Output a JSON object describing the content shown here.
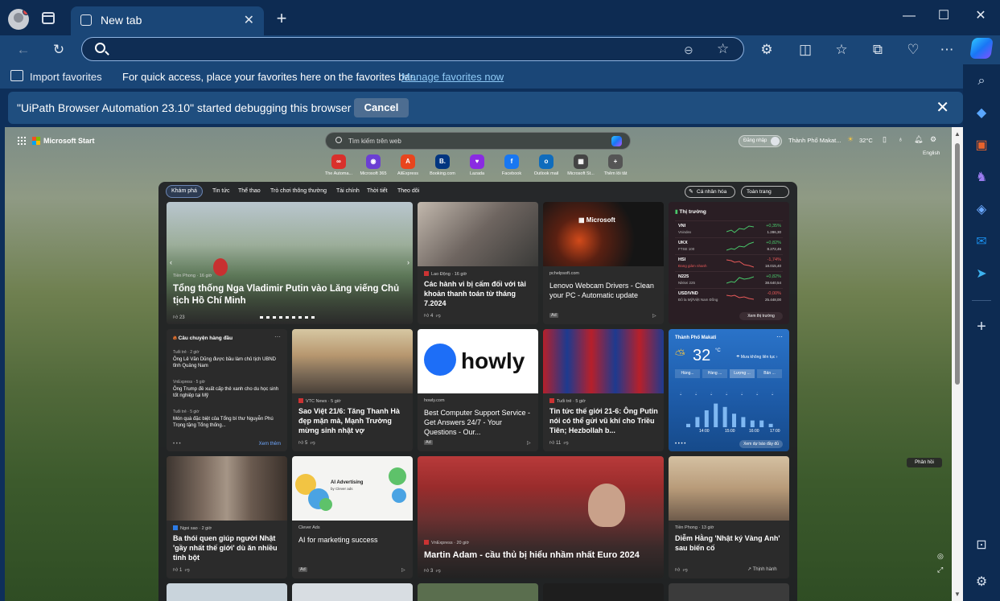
{
  "tab": {
    "title": "New tab"
  },
  "favorites_bar": {
    "import_label": "Import favorites",
    "hint": "For quick access, place your favorites here on the favorites bar.",
    "manage_link": "Manage favorites now"
  },
  "infobar": {
    "message": "\"UiPath Browser Automation 23.10\" started debugging this browser",
    "cancel_label": "Cancel"
  },
  "ms_start": {
    "brand": "Microsoft Start",
    "search_placeholder": "Tìm kiếm trên web",
    "signin_label": "Đăng nhập",
    "city": "Thành Phố Makat...",
    "temperature": "32°C",
    "language": "English"
  },
  "quick_links": [
    {
      "label": "The Automa...",
      "color": "#d9302c",
      "glyph": "∞"
    },
    {
      "label": "Microsoft 365",
      "color": "#6b3fd3",
      "glyph": "◉"
    },
    {
      "label": "AliExpress",
      "color": "#e8451e",
      "glyph": "A"
    },
    {
      "label": "Booking.com",
      "color": "#003580",
      "glyph": "B."
    },
    {
      "label": "Lazada",
      "color": "#8a2be2",
      "glyph": "♥"
    },
    {
      "label": "Facebook",
      "color": "#1877f2",
      "glyph": "f"
    },
    {
      "label": "Outlook mail",
      "color": "#0f6cbd",
      "glyph": "o"
    },
    {
      "label": "Microsoft St...",
      "color": "#444444",
      "glyph": "▦"
    },
    {
      "label": "Thêm lối tắt",
      "color": "#555555",
      "glyph": "+"
    }
  ],
  "feed_nav": {
    "items": [
      "Khám phá",
      "Tin tức",
      "Thể thao",
      "Trò chơi thông thường",
      "Tài chính",
      "Thời tiết",
      "Theo dõi"
    ],
    "personalize": "Cá nhân hóa",
    "full_page": "Toàn trang"
  },
  "cards": {
    "hero": {
      "source": "Tiền Phong · 16 giờ",
      "title": "Tổng thống Nga Vladimir Putin vào Lăng viếng Chủ tịch Hồ Chí Minh",
      "likes": "23"
    },
    "bank": {
      "source": "Lao Động · 16 giờ",
      "title": "Các hành vi bị cấm đối với tài khoản thanh toán từ tháng 7.2024",
      "likes": "4"
    },
    "lenovo": {
      "source": "pchelpsoft.com",
      "title": "Lenovo Webcam Drivers - Clean your PC - Automatic update",
      "ad": "Ad"
    },
    "howly": {
      "source": "howly.com",
      "title": "Best Computer Support Service - Get Answers 24/7 - Your Questions - Our...",
      "ad": "Ad",
      "logo": "howly"
    },
    "sao_viet": {
      "source": "VTC News · 5 giờ",
      "title": "Sao Việt 21/6: Tăng Thanh Hà đẹp mặn mà, Mạnh Trường mừng sinh nhật vợ",
      "likes": "5"
    },
    "world": {
      "source": "Tuổi trẻ · 5 giờ",
      "title": "Tin tức thế giới 21-6: Ông Putin nói có thể gửi vũ khí cho Triều Tiên; Hezbollah b...",
      "likes": "11"
    },
    "habits": {
      "source": "Ngoi sao · 2 giờ",
      "title": "Ba thói quen giúp người Nhật 'gầy nhất thế giới' dù ăn nhiều tinh bột",
      "likes": "1"
    },
    "clever": {
      "source": "Clever Ads",
      "title": "AI for marketing success",
      "ad": "Ad",
      "banner_title": "AI Advertising",
      "banner_sub": "by Clever ads"
    },
    "euro": {
      "source": "VnExpress · 20 giờ",
      "title": "Martin Adam - cầu thủ bị hiểu nhầm nhất Euro 2024",
      "likes": "3"
    },
    "diem_hang": {
      "source": "Tiền Phong · 13 giờ",
      "title": "Diễm Hằng 'Nhật ký Vàng Anh' sau biến cố",
      "trending": "Thịnh hành"
    }
  },
  "markets": {
    "title": "Thị trường",
    "more": "Xem thị trường",
    "rows": [
      {
        "name": "VNI",
        "sub": "Vnindex",
        "change": "+0,35%",
        "value": "1.286,30",
        "up": true
      },
      {
        "name": "UKX",
        "sub": "FTSE 100",
        "change": "+0,82%",
        "value": "8.272,46",
        "up": true
      },
      {
        "name": "HSI",
        "sub": "Đang giảm nhanh",
        "change": "-1,74%",
        "value": "18.015,40",
        "up": false
      },
      {
        "name": "N225",
        "sub": "Nikkei 225",
        "change": "+0,82%",
        "value": "38.640,54",
        "up": true
      },
      {
        "name": "USD/VND",
        "sub": "Đô la Mỹ/Việt Nam Đồng",
        "change": "-0,00%",
        "value": "25.448,00",
        "up": false
      }
    ]
  },
  "trending": {
    "title": "Câu chuyện hàng đầu",
    "more": "Xem thêm",
    "items": [
      {
        "source": "Tuổi trẻ · 2 giờ",
        "title": "Ông Lê Văn Dũng được bầu làm chủ tịch UBND tỉnh Quảng Nam"
      },
      {
        "source": "VnExpress · 5 giờ",
        "title": "Ông Trump đề xuất cấp thẻ xanh cho du học sinh tốt nghiệp tại Mỹ"
      },
      {
        "source": "Tuổi trẻ · 5 giờ",
        "title": "Món quà đặc biệt của Tổng bí thư Nguyễn Phú Trọng tặng Tổng thống..."
      }
    ]
  },
  "weather": {
    "city": "Thành Phố Makati",
    "temp": "32",
    "unit": "°C",
    "rain_note": "Mưa không liên tục",
    "tabs": [
      "Hàng...",
      "Hàng ...",
      "Lượng ...",
      "Bản ..."
    ],
    "times": [
      "14:00",
      "15:00",
      "16:00",
      "17:00"
    ],
    "more": "Xem dự báo đầy đủ",
    "rain_levels": [
      0.1,
      0.3,
      0.5,
      0.7,
      0.6,
      0.4,
      0.3,
      0.2,
      0.2,
      0.1
    ]
  },
  "feedback": "Phản hồi"
}
